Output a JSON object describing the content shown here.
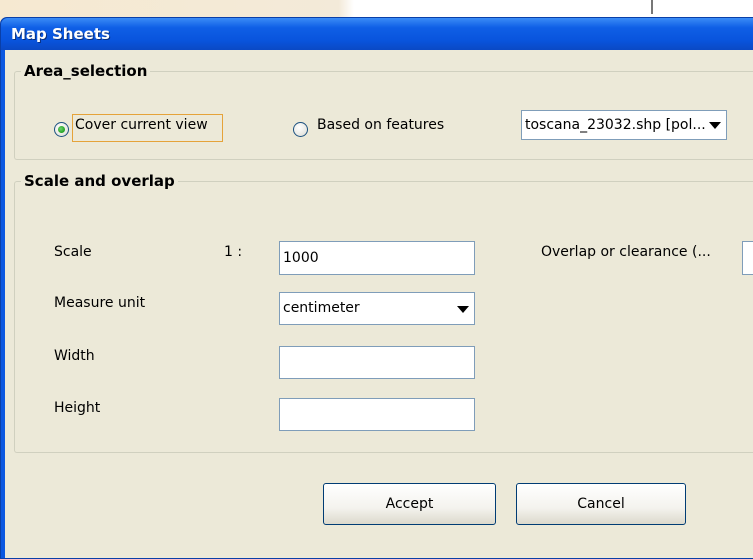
{
  "window": {
    "title": "Map Sheets"
  },
  "area_selection": {
    "legend": "Area_selection",
    "options": [
      {
        "label": "Cover current view",
        "selected": true
      },
      {
        "label": "Based on features",
        "selected": false
      }
    ],
    "layer_select": {
      "value": "toscana_23032.shp [pol..."
    }
  },
  "scale_overlap": {
    "legend": "Scale and overlap",
    "scale": {
      "label": "Scale",
      "prefix": "1 :",
      "value": "1000"
    },
    "overlap": {
      "label": "Overlap or clearance (...",
      "value": ""
    },
    "measure_unit": {
      "label": "Measure unit",
      "value": "centimeter"
    },
    "width": {
      "label": "Width",
      "value": ""
    },
    "height": {
      "label": "Height",
      "value": ""
    }
  },
  "buttons": {
    "accept": "Accept",
    "cancel": "Cancel"
  },
  "colors": {
    "title_bar": "#0b58e1",
    "dialog_bg": "#ece9d8",
    "focus": "#e5a33a"
  },
  "icons": {
    "dropdown": "chevron-down-icon",
    "radio_selected": "radio-checked-icon",
    "radio_unselected": "radio-unchecked-icon"
  }
}
